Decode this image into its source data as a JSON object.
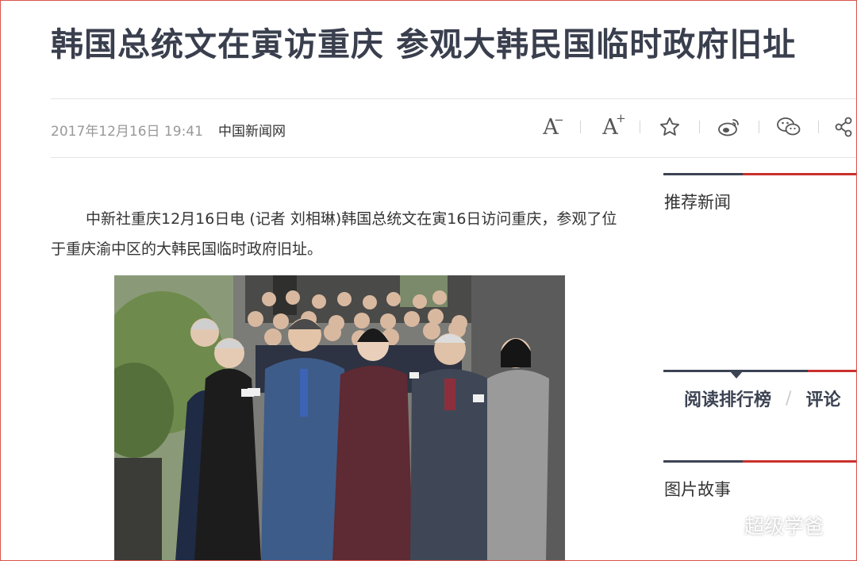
{
  "article": {
    "title": "韩国总统文在寅访重庆 参观大韩民国临时政府旧址",
    "date": "2017年12月16日 19:41",
    "source": "中国新闻网",
    "body": "中新社重庆12月16日电 (记者 刘相琳)韩国总统文在寅16日访问重庆，参观了位于重庆渝中区的大韩民国临时政府旧址。"
  },
  "toolbar": {
    "font_decrease": "A",
    "font_increase": "A",
    "icons": [
      "font-decrease-icon",
      "font-increase-icon",
      "star-icon",
      "weibo-icon",
      "wechat-icon",
      "share-icon"
    ]
  },
  "sidebar": {
    "recommended_title": "推荐新闻",
    "ranking_tabs": [
      "阅读排行榜",
      "评论"
    ],
    "photo_story_title": "图片故事"
  },
  "watermark": {
    "text": "超级学爸"
  },
  "colors": {
    "title": "#3a3f4e",
    "accent_red": "#c9302c",
    "accent_dark": "#3c4353",
    "meta_gray": "#999999"
  }
}
